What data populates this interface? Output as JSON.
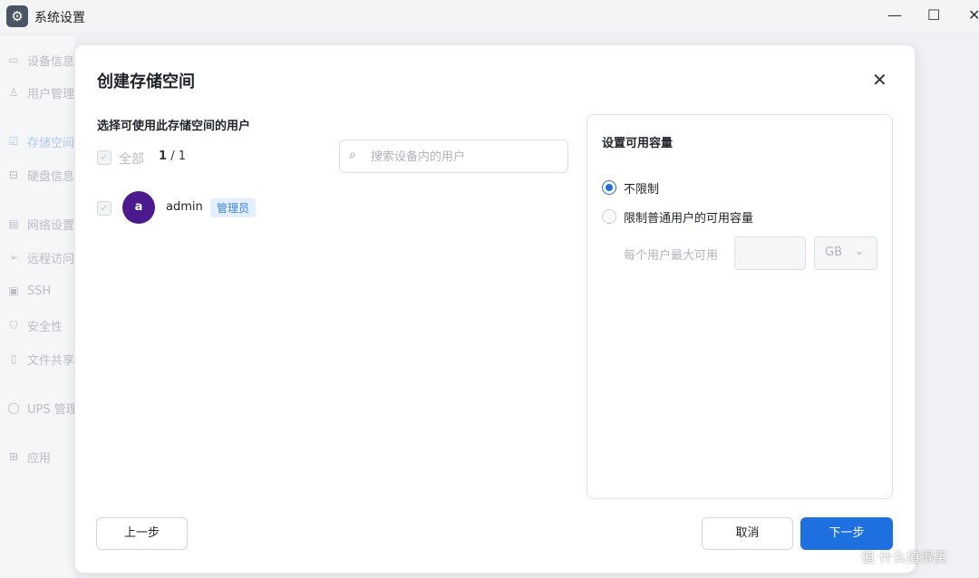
{
  "window": {
    "title": "系统设置",
    "minimize_icon": "—",
    "maximize_icon": "☐",
    "close_icon": "✕"
  },
  "sidebar": {
    "items": [
      {
        "label": "设备信息",
        "icon": "monitor-icon",
        "glyph": "▭"
      },
      {
        "label": "用户管理",
        "icon": "user-icon",
        "glyph": "♙"
      },
      {
        "label": "存储空间",
        "icon": "storage-icon",
        "glyph": "☑"
      },
      {
        "label": "硬盘信息",
        "icon": "disk-icon",
        "glyph": "⊟"
      },
      {
        "label": "网络设置",
        "icon": "network-icon",
        "glyph": "▤"
      },
      {
        "label": "远程访问",
        "icon": "send-icon",
        "glyph": "➢"
      },
      {
        "label": "SSH",
        "icon": "terminal-icon",
        "glyph": "▣"
      },
      {
        "label": "安全性",
        "icon": "shield-icon",
        "glyph": "⛉"
      },
      {
        "label": "文件共享",
        "icon": "file-icon",
        "glyph": "▯"
      },
      {
        "label": "UPS 管理",
        "icon": "ups-icon",
        "glyph": "◯"
      },
      {
        "label": "应用",
        "icon": "apps-icon",
        "glyph": "⊞"
      }
    ]
  },
  "dialog": {
    "title": "创建存储空间",
    "close_glyph": "✕",
    "users_section_label": "选择可使用此存储空间的用户",
    "select_all_label": "全部",
    "selected_count": "1",
    "total_count": "/ 1",
    "search_placeholder": "搜索设备内的用户",
    "search_glyph": "⌕",
    "users": [
      {
        "avatar_letter": "a",
        "name": "admin",
        "role": "管理员",
        "avatar_color": "#4b1a8c"
      }
    ],
    "capacity_panel": {
      "title": "设置可用容量",
      "options": [
        {
          "label": "不限制",
          "selected": true
        },
        {
          "label": "限制普通用户的可用容量",
          "selected": false
        }
      ],
      "max_per_user_label": "每个用户最大可用",
      "unit_value": "GB",
      "unit_chevron": "⌄"
    },
    "buttons": {
      "prev": "上一步",
      "cancel": "取消",
      "next": "下一步"
    }
  },
  "watermark": "值 什么值得买",
  "colors": {
    "primary": "#1e6fe0",
    "badge_bg": "#e3effd",
    "badge_text": "#3b82d8"
  }
}
